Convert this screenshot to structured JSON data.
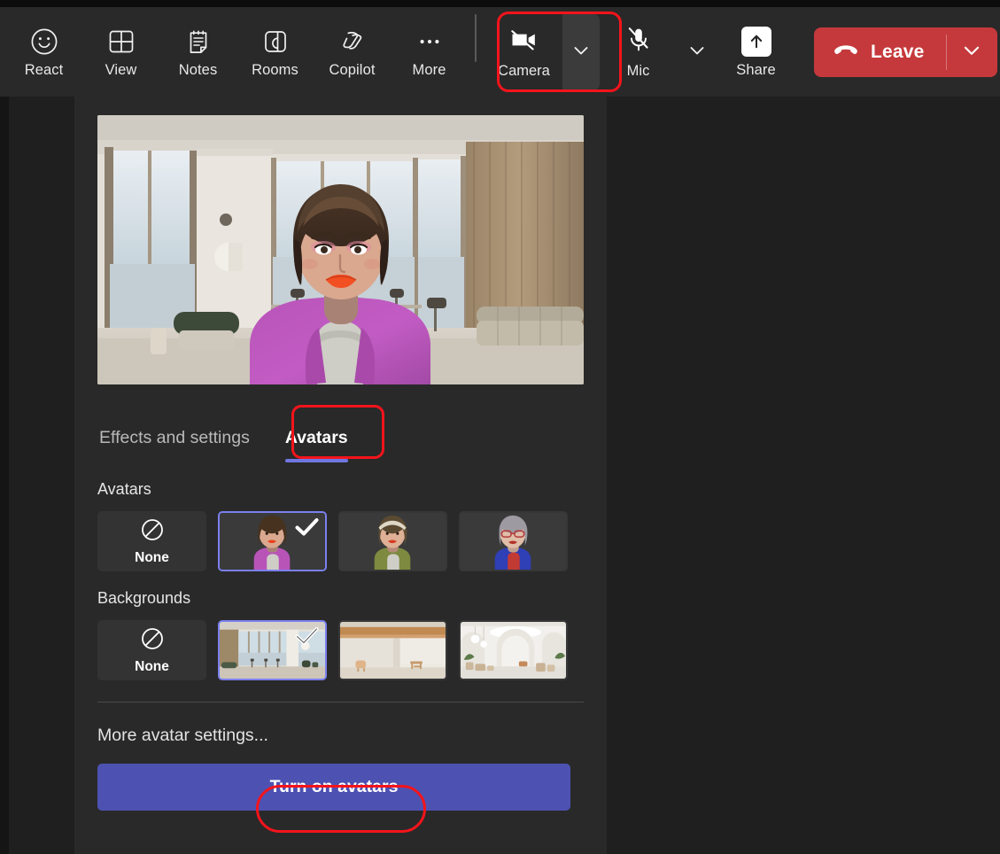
{
  "toolbar": {
    "buttons": [
      {
        "label": "React",
        "icon": "emoji-smile-icon"
      },
      {
        "label": "View",
        "icon": "grid-view-icon"
      },
      {
        "label": "Notes",
        "icon": "notes-icon"
      },
      {
        "label": "Rooms",
        "icon": "breakout-rooms-icon"
      },
      {
        "label": "Copilot",
        "icon": "copilot-icon"
      },
      {
        "label": "More",
        "icon": "more-ellipsis-icon"
      }
    ],
    "camera": {
      "label": "Camera",
      "icon": "camera-off-icon",
      "state": "off",
      "caret": "chevron-down-icon"
    },
    "mic": {
      "label": "Mic",
      "icon": "mic-muted-icon",
      "state": "muted",
      "caret": "chevron-down-icon"
    },
    "share": {
      "label": "Share",
      "icon": "share-screen-icon"
    },
    "leave": {
      "label": "Leave",
      "icon": "hang-up-icon",
      "caret": "chevron-down-icon"
    }
  },
  "panel": {
    "tabs": [
      {
        "label": "Effects and settings",
        "active": false
      },
      {
        "label": "Avatars",
        "active": true
      }
    ],
    "avatars": {
      "title": "Avatars",
      "none_label": "None",
      "items": [
        {
          "name": "avatar-none",
          "selected": false
        },
        {
          "name": "avatar-purple-cardigan",
          "selected": true
        },
        {
          "name": "avatar-green-cardigan",
          "selected": false
        },
        {
          "name": "avatar-blue-blazer",
          "selected": false
        }
      ]
    },
    "backgrounds": {
      "title": "Backgrounds",
      "none_label": "None",
      "items": [
        {
          "name": "background-none",
          "selected": false
        },
        {
          "name": "background-penthouse-lounge",
          "selected": true
        },
        {
          "name": "background-wood-beam-loft",
          "selected": false
        },
        {
          "name": "background-white-gallery",
          "selected": false
        }
      ]
    },
    "more_settings_label": "More avatar settings...",
    "cta_label": "Turn on avatars"
  },
  "colors": {
    "leave_red": "#c5393c",
    "accent_purple": "#4d52b2",
    "tab_underline": "#6f76e0",
    "selection_border": "#7b80ef",
    "annotation_red": "#f4141b",
    "toolbar_bg": "#292929",
    "panel_bg": "#292929"
  },
  "annotations": [
    {
      "name": "camera-button-highlight",
      "target": "Camera"
    },
    {
      "name": "avatars-tab-highlight",
      "target": "Avatars"
    },
    {
      "name": "turn-on-avatars-highlight",
      "target": "Turn on avatars"
    }
  ]
}
